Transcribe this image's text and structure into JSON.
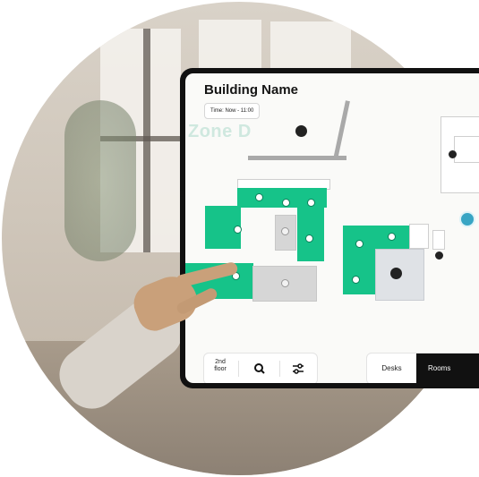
{
  "header": {
    "title": "Building Name",
    "time_chip": "Time: Now - 11:00"
  },
  "map": {
    "zone_label": "Zone D"
  },
  "toolbar": {
    "floor_label_top": "2nd",
    "floor_label_bottom": "floor",
    "search_icon": "search-icon",
    "filter_icon": "sliders-icon"
  },
  "view_toggle": {
    "desks_label": "Desks",
    "rooms_label": "Rooms",
    "selected": "Rooms"
  },
  "colors": {
    "available_room": "#16c389",
    "occupied_room": "#d6d6d6",
    "accent_dot": "#38a5c4"
  }
}
